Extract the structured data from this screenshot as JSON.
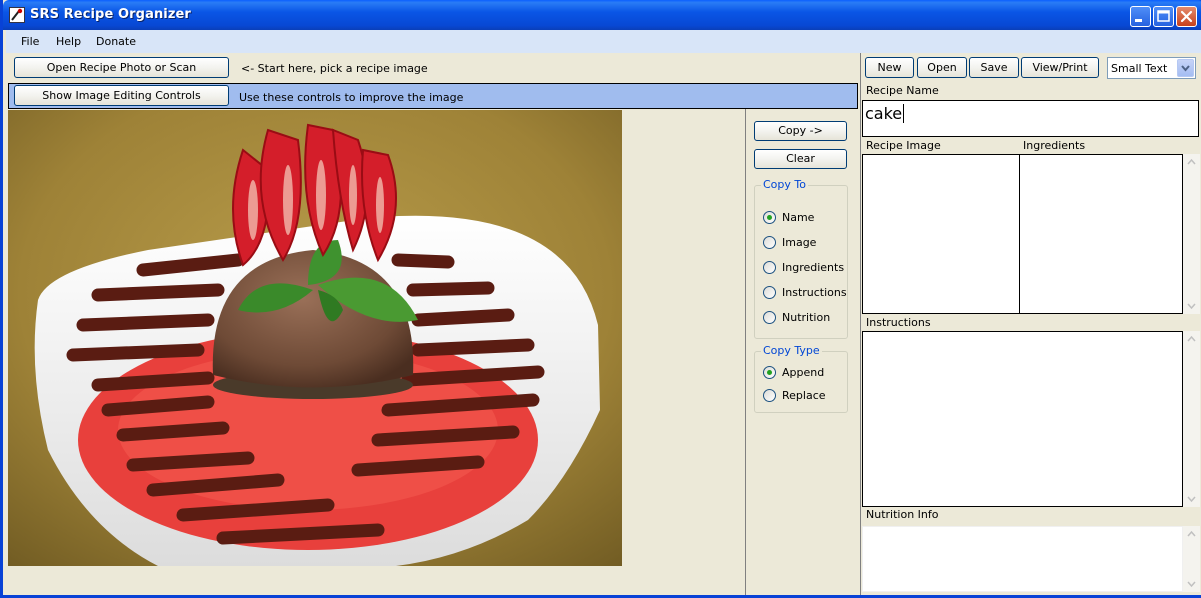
{
  "window": {
    "title": "SRS Recipe Organizer",
    "controls": [
      "minimize-icon",
      "maximize-icon",
      "close-icon"
    ]
  },
  "menu": [
    "File",
    "Help",
    "Donate"
  ],
  "left": {
    "open_button": "Open Recipe Photo or Scan",
    "open_hint": "<- Start here, pick a recipe image",
    "editing_button": "Show Image Editing Controls",
    "editing_hint": "Use these controls to improve the image"
  },
  "copy_panel": {
    "copy_button": "Copy ->",
    "clear_button": "Clear",
    "copy_to": {
      "title": "Copy To",
      "options": [
        "Name",
        "Image",
        "Ingredients",
        "Instructions",
        "Nutrition"
      ],
      "selected": "Name"
    },
    "copy_type": {
      "title": "Copy Type",
      "options": [
        "Append",
        "Replace"
      ],
      "selected": "Append"
    }
  },
  "right": {
    "buttons": [
      "New",
      "Open",
      "Save",
      "View/Print"
    ],
    "text_size": "Small Text",
    "recipe_name_label": "Recipe Name",
    "recipe_name_value": "cake",
    "recipe_image_label": "Recipe Image",
    "ingredients_label": "Ingredients",
    "instructions_label": "Instructions",
    "nutrition_label": "Nutrition Info"
  },
  "colors": {
    "titlebar": "#0a56e6",
    "menubar": "#d8e5f8",
    "strip": "#a0bcee",
    "face": "#ece9d8",
    "radio_dot": "#21a121",
    "group_title": "#0046d5"
  }
}
